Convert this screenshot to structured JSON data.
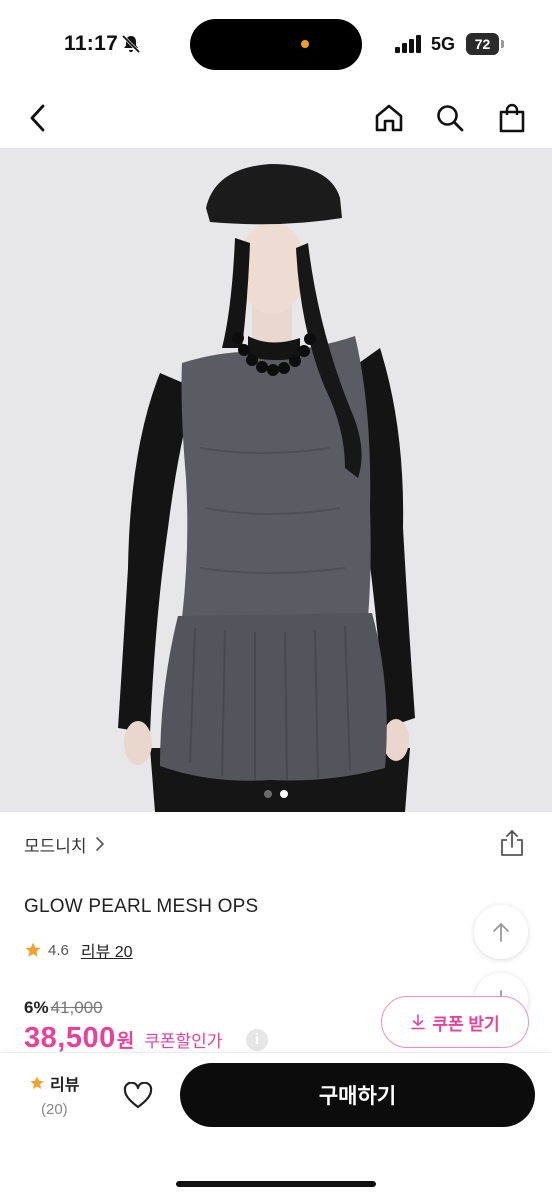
{
  "status_bar": {
    "time": "11:17",
    "network": "5G",
    "battery": "72",
    "icons": [
      "bell-slash-icon",
      "signal-icon"
    ]
  },
  "nav": {
    "icons": [
      "back-chevron-icon",
      "home-icon",
      "search-icon",
      "shopping-bag-icon"
    ]
  },
  "hero": {
    "current_index": 0,
    "dot_count": 2,
    "colors": {
      "background": "#e7e6e9",
      "top": "#5a5b62",
      "sleeves": "#111111",
      "active_dot": "#ffffff",
      "inactive_dot": "#6b6b6b"
    }
  },
  "product": {
    "brand": "모드니치",
    "brand_chevron": ">",
    "name": "GLOW PEARL MESH OPS",
    "rating": "4.6",
    "review_link": "리뷰 20",
    "discount": "6%",
    "original_price": "41,000",
    "sale_price": "38,500",
    "price_unit": "원",
    "coupon_price_label": "쿠폰할인가",
    "info_glyph": "i",
    "coupon_button_label": "쿠폰 받기"
  },
  "floating": {
    "icons": [
      "arrow-up-icon",
      "arrow-down-icon"
    ]
  },
  "bottom_bar": {
    "review_label": "리뷰",
    "review_count": "(20)",
    "buy_label": "구매하기",
    "icons": [
      "star-icon",
      "heart-icon"
    ]
  },
  "colors": {
    "accent": "#e7419b",
    "coupon_border": "#f08fc4",
    "star": "#f2a230",
    "buy_button": "#0c0c0c"
  }
}
